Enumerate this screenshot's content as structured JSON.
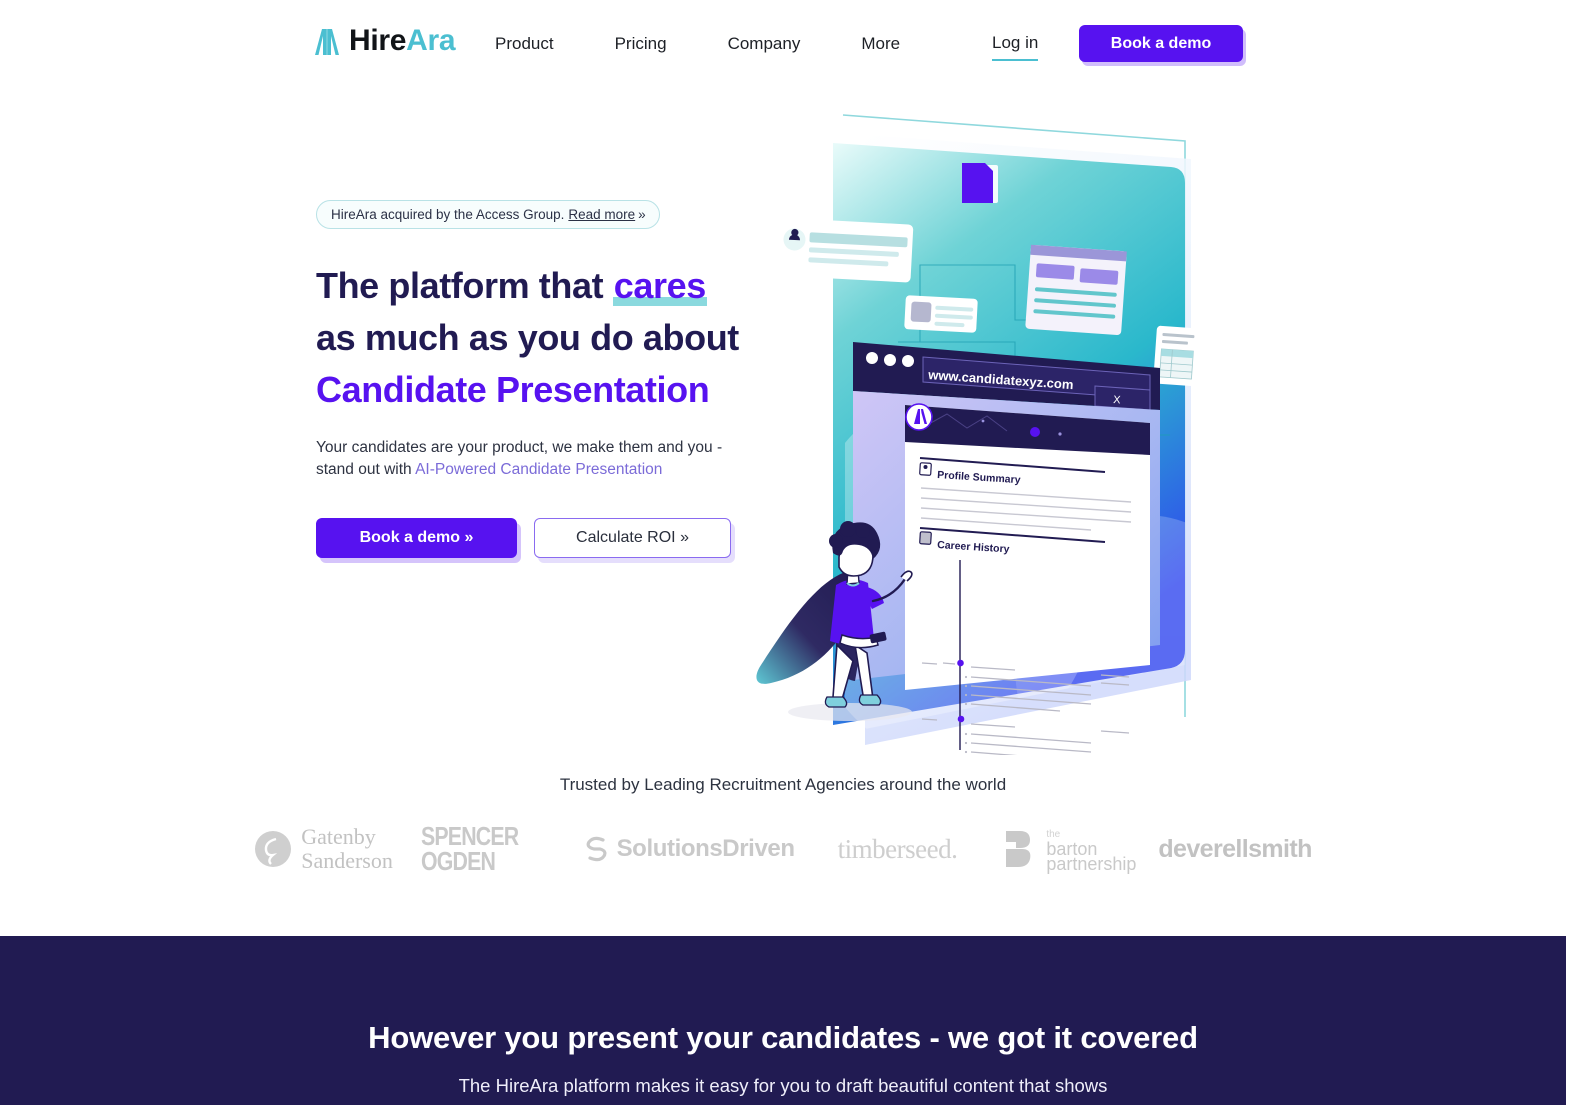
{
  "brand": {
    "logo_hire": "Hire",
    "logo_ara": "Ara",
    "accent_teal": "#4BBFD1",
    "accent_purple": "#5712F0",
    "dark_navy": "#211b52"
  },
  "header": {
    "nav": [
      {
        "label": "Product"
      },
      {
        "label": "Pricing"
      },
      {
        "label": "Company"
      },
      {
        "label": "More"
      }
    ],
    "login_label": "Log in",
    "demo_button_label": "Book a demo"
  },
  "hero": {
    "announcement": {
      "text": "HireAra acquired by the Access Group.",
      "link_label": "Read more",
      "chevron": "»"
    },
    "title_line1_plain": "The platform that ",
    "title_line1_highlight": "cares",
    "title_line2": "as much as you do about",
    "title_line3": "Candidate Presentation",
    "subtitle_plain": "Your candidates are your product, we make them and you - stand out with ",
    "subtitle_link": "AI-Powered Candidate Presentation",
    "primary_button": "Book a demo »",
    "secondary_button": "Calculate ROI »"
  },
  "illustration": {
    "browser_url": "www.candidatexyz.com",
    "browser_close": "X",
    "doc_section_1": "Profile Summary",
    "doc_section_2": "Career History"
  },
  "trusted": {
    "title": "Trusted by Leading Recruitment Agencies around the world",
    "logos": [
      {
        "name": "gatenby-sanderson",
        "line1": "Gatenby",
        "line2": "Sanderson"
      },
      {
        "name": "spencer-ogden",
        "line1": "SPENCER",
        "line2": "OGDEN"
      },
      {
        "name": "solutions-driven",
        "line1": "SolutionsDriven",
        "line2": ""
      },
      {
        "name": "timberseed",
        "line1": "timberseed.",
        "line2": ""
      },
      {
        "name": "barton-partnership",
        "line1": "barton",
        "line2": "partnership",
        "line0": "the"
      },
      {
        "name": "deverellsmith",
        "line1": "deverellsmith",
        "line2": ""
      }
    ]
  },
  "dark_section": {
    "title": "However you present your candidates - we got it covered",
    "subtitle": "The HireAra platform makes it easy for you to draft beautiful content that shows"
  }
}
